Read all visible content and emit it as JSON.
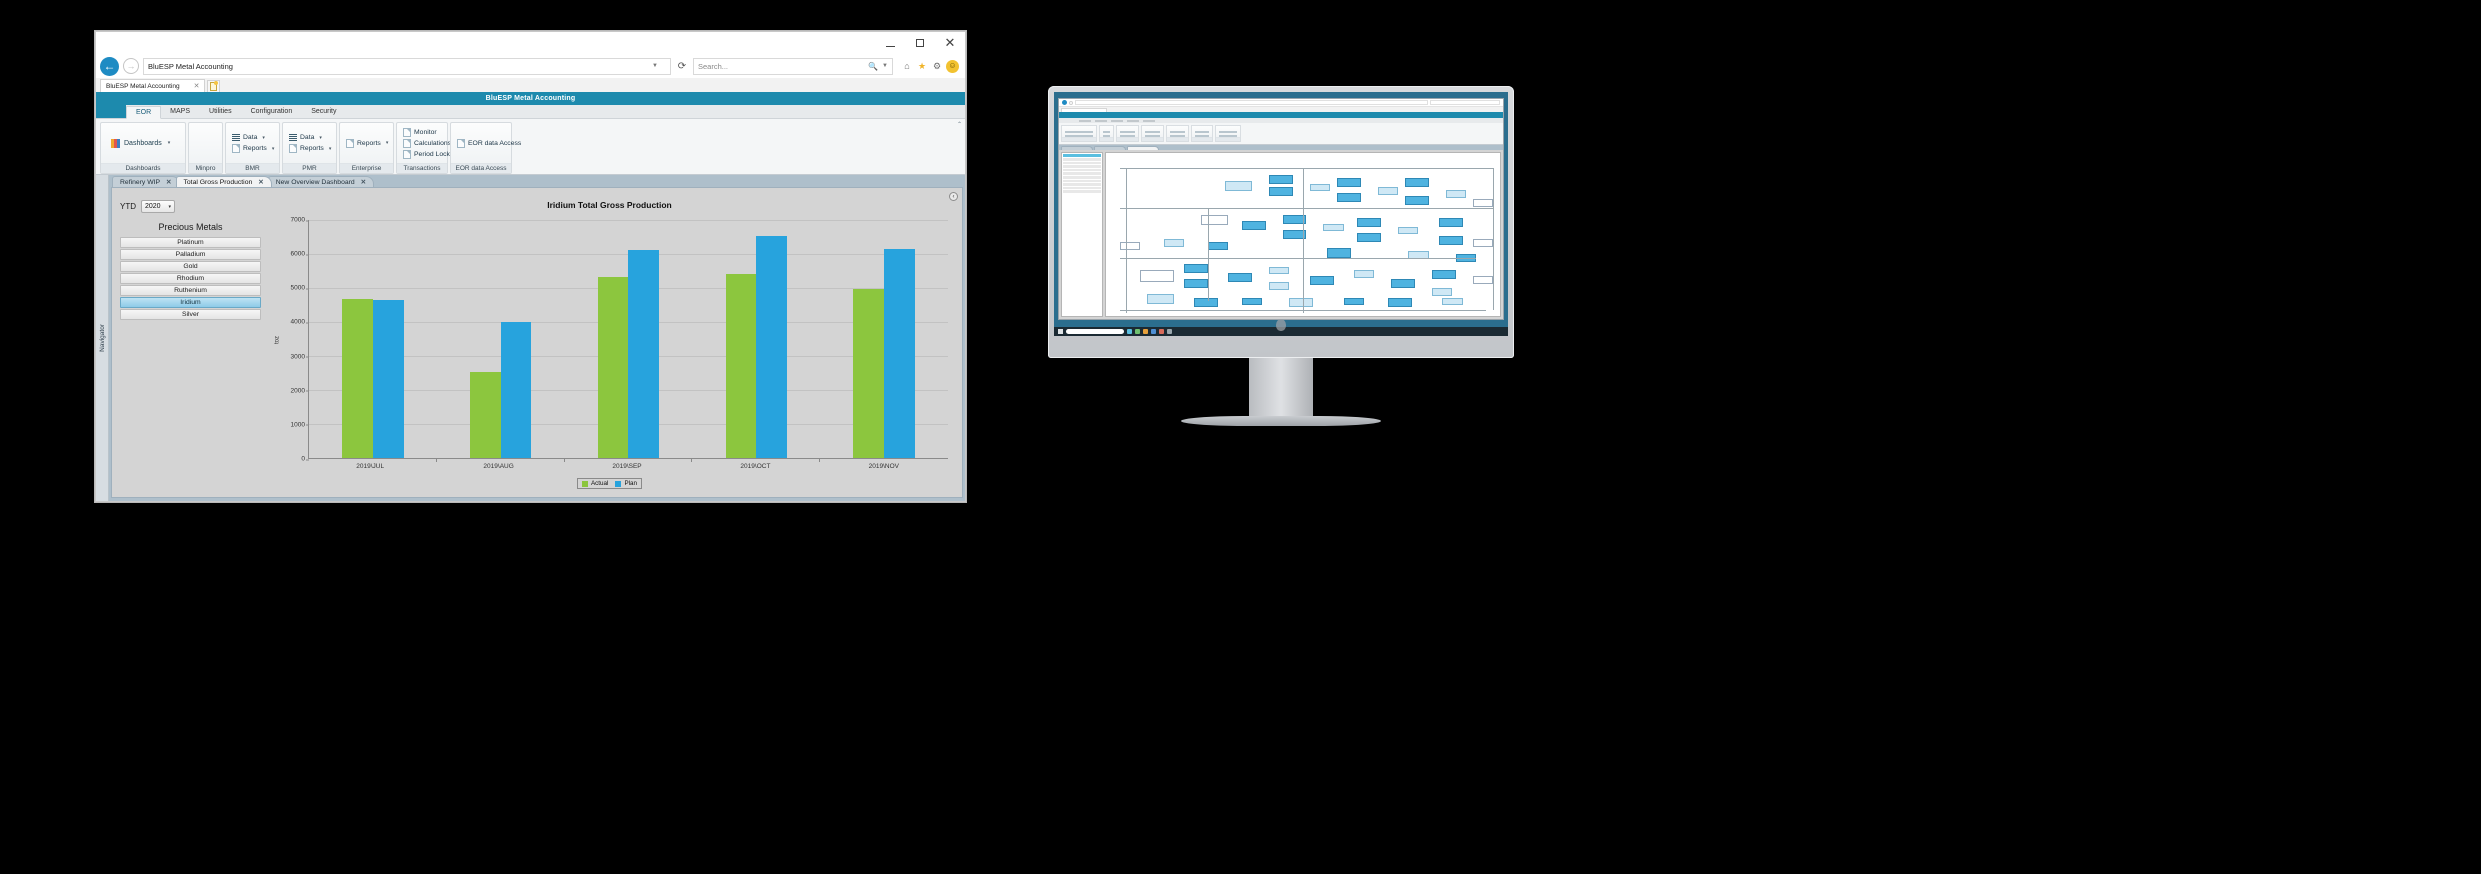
{
  "browser": {
    "window_title": "",
    "address_value": "BluESP Metal Accounting",
    "search_placeholder": "Search...",
    "tab_label": "BluESP Metal Accounting",
    "tab_close": "✕",
    "back_icon": "←",
    "forward_icon": "→",
    "refresh_icon": "⟳",
    "address_caret": "▼",
    "search_caret": "▼",
    "minimize_label": "─",
    "maximize_label": "☐",
    "close_label": "✕",
    "nav_icons": [
      "home-icon",
      "star-icon",
      "gear-icon",
      "smiley-icon"
    ],
    "home_glyph": "⌂",
    "star_glyph": "★",
    "gear_glyph": "⚙",
    "smiley_glyph": "☺"
  },
  "app": {
    "header_title": "BluESP Metal Accounting",
    "ribbon_tabs": [
      {
        "label": "EOR",
        "active": true
      },
      {
        "label": "MAPS",
        "active": false
      },
      {
        "label": "Utilities",
        "active": false
      },
      {
        "label": "Configuration",
        "active": false
      },
      {
        "label": "Security",
        "active": false
      }
    ],
    "ribbon_collapse_glyph": "⌃",
    "ribbon_groups": [
      {
        "label": "Dashboards",
        "big": {
          "text": "Dashboards",
          "icon": "dashboard-icon",
          "caret": "▾"
        },
        "items": []
      },
      {
        "label": "Minpro",
        "big": null,
        "items": []
      },
      {
        "label": "BMR",
        "big": null,
        "items": [
          {
            "text": "Data",
            "icon": "data-list-icon",
            "caret": "▾"
          },
          {
            "text": "Reports",
            "icon": "report-doc-icon",
            "caret": "▾"
          }
        ]
      },
      {
        "label": "PMR",
        "big": null,
        "items": [
          {
            "text": "Data",
            "icon": "data-list-icon",
            "caret": "▾"
          },
          {
            "text": "Reports",
            "icon": "report-doc-icon",
            "caret": "▾"
          }
        ]
      },
      {
        "label": "Enterprise",
        "big": null,
        "items": [
          {
            "text": "Reports",
            "icon": "report-doc-icon",
            "caret": "▾"
          }
        ]
      },
      {
        "label": "Transactions",
        "big": null,
        "items": [
          {
            "text": "Monitor",
            "icon": "monitor-doc-icon",
            "caret": ""
          },
          {
            "text": "Calculations",
            "icon": "calculations-doc-icon",
            "caret": ""
          },
          {
            "text": "Period Lock",
            "icon": "period-lock-doc-icon",
            "caret": ""
          }
        ]
      },
      {
        "label": "EOR data Access",
        "big": null,
        "items": [
          {
            "text": "EOR data Access",
            "icon": "eor-data-access-doc-icon",
            "caret": ""
          }
        ]
      }
    ],
    "navigator_label": "Navigator",
    "doc_tabs": [
      {
        "label": "Refinery WIP",
        "active": false,
        "close": "✕"
      },
      {
        "label": "Total Gross Production",
        "active": true,
        "close": "✕"
      },
      {
        "label": "New Overview  Dashboard",
        "active": false,
        "close": "✕"
      }
    ],
    "panel_collapse_glyph": "‹"
  },
  "filters": {
    "ytd_label": "YTD",
    "year_value": "2020",
    "year_caret": "▾",
    "metals_title": "Precious Metals",
    "metals": [
      {
        "name": "Platinum",
        "selected": false
      },
      {
        "name": "Palladium",
        "selected": false
      },
      {
        "name": "Gold",
        "selected": false
      },
      {
        "name": "Rhodium",
        "selected": false
      },
      {
        "name": "Ruthenium",
        "selected": false
      },
      {
        "name": "Iridium",
        "selected": true
      },
      {
        "name": "Silver",
        "selected": false
      }
    ]
  },
  "colors": {
    "accent_header": "#1d8aad",
    "actual": "#8cc63e",
    "plan": "#27a3dd",
    "selection": "#8ecbe8"
  },
  "chart_data": {
    "type": "bar",
    "title": "Iridium Total Gross Production",
    "xlabel": "",
    "ylabel": "toz",
    "categories": [
      "2019\\JUL",
      "2019\\AUG",
      "2019\\SEP",
      "2019\\OCT",
      "2019\\NOV"
    ],
    "series": [
      {
        "name": "Actual",
        "color": "#8cc63e",
        "values": [
          4670,
          2520,
          5310,
          5420,
          4980
        ]
      },
      {
        "name": "Plan",
        "color": "#27a3dd",
        "values": [
          4650,
          3990,
          6130,
          6540,
          6160
        ]
      }
    ],
    "ylim": [
      0,
      7000
    ],
    "yticks": [
      0,
      1000,
      2000,
      3000,
      4000,
      5000,
      6000,
      7000
    ],
    "grid": true,
    "legend_position": "bottom-center",
    "legend": [
      "Actual",
      "Plan"
    ]
  },
  "monitor": {
    "screen_app_title": "BluESP Metal Accounting",
    "search_placeholder": "Type here to search",
    "tree_items": [
      "Publish",
      "Palladium",
      "Gold",
      "Rhodium",
      "Ruthenium",
      "Iridium",
      "Silver",
      "Nickel",
      "Copper",
      "Cobalt"
    ],
    "summary_label": "Summary"
  }
}
